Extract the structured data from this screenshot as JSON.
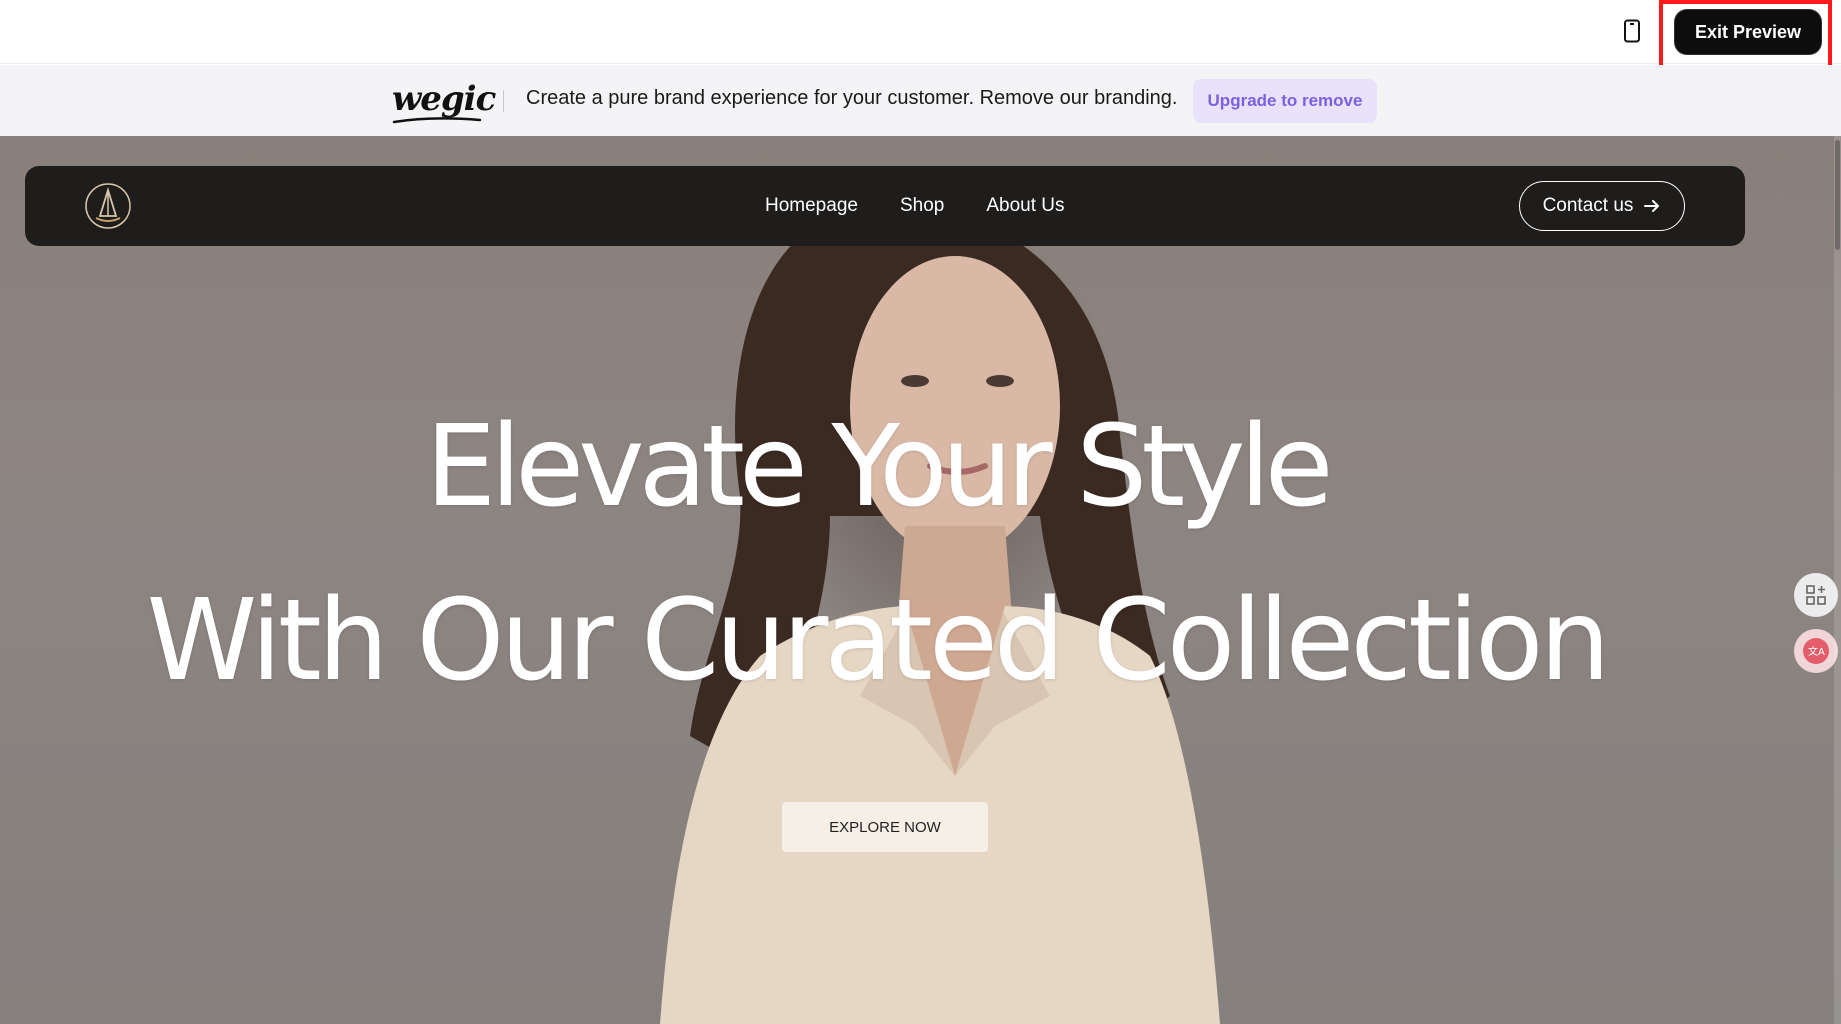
{
  "topbar": {
    "device_icon": "mobile-phone-icon",
    "exit_label": "Exit Preview"
  },
  "brandbar": {
    "logo_text": "wegic",
    "message": "Create a pure brand experience for your customer. Remove our branding.",
    "upgrade_label": "Upgrade to remove",
    "accent_color": "#7b61e0"
  },
  "site": {
    "logo_icon": "sailboat-logo-icon",
    "nav": [
      {
        "label": "Homepage"
      },
      {
        "label": "Shop"
      },
      {
        "label": "About Us"
      }
    ],
    "contact_label": "Contact us",
    "contact_icon": "arrow-right-icon",
    "hero": {
      "headline_line1": "Elevate Your Style",
      "headline_line2": "With Our Curated Collection",
      "cta_label": "EXPLORE NOW"
    }
  },
  "floating_tools": [
    {
      "icon": "apps-add-icon"
    },
    {
      "icon": "translate-icon"
    }
  ]
}
